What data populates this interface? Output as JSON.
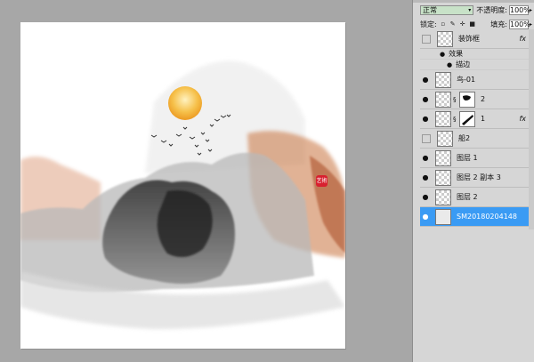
{
  "layers_panel": {
    "blend_mode": "正常",
    "opacity_label": "不透明度:",
    "opacity_value": "100%",
    "lock_label": "锁定:",
    "fill_label": "填充:",
    "fill_value": "100%",
    "layers": [
      {
        "name": "装饰框",
        "visible": false,
        "fx": "fx"
      },
      {
        "name": "鸟-01",
        "visible": true
      },
      {
        "name": "2",
        "visible": true,
        "has_mask": true
      },
      {
        "name": "1",
        "visible": true,
        "has_mask": true,
        "fx": "fx"
      },
      {
        "name": "船2",
        "visible": false
      },
      {
        "name": "图层 1",
        "visible": true
      },
      {
        "name": "图层 2 副本 3",
        "visible": true
      },
      {
        "name": "图层 2",
        "visible": true
      },
      {
        "name": "SM20180204148",
        "visible": true,
        "selected": true
      }
    ],
    "effects_label": "效果",
    "stroke_label": "描边"
  },
  "icons": {
    "eye": "eye-icon",
    "chain": "link-icon",
    "lock": "lock-icon",
    "effects": "fx-icon"
  },
  "canvas": {
    "seal_text": "艺術",
    "colors": {
      "sun": "#f1b23a",
      "ink": "#3e3e3e",
      "rust": "#c96a3a",
      "seal": "#d8202f"
    }
  }
}
